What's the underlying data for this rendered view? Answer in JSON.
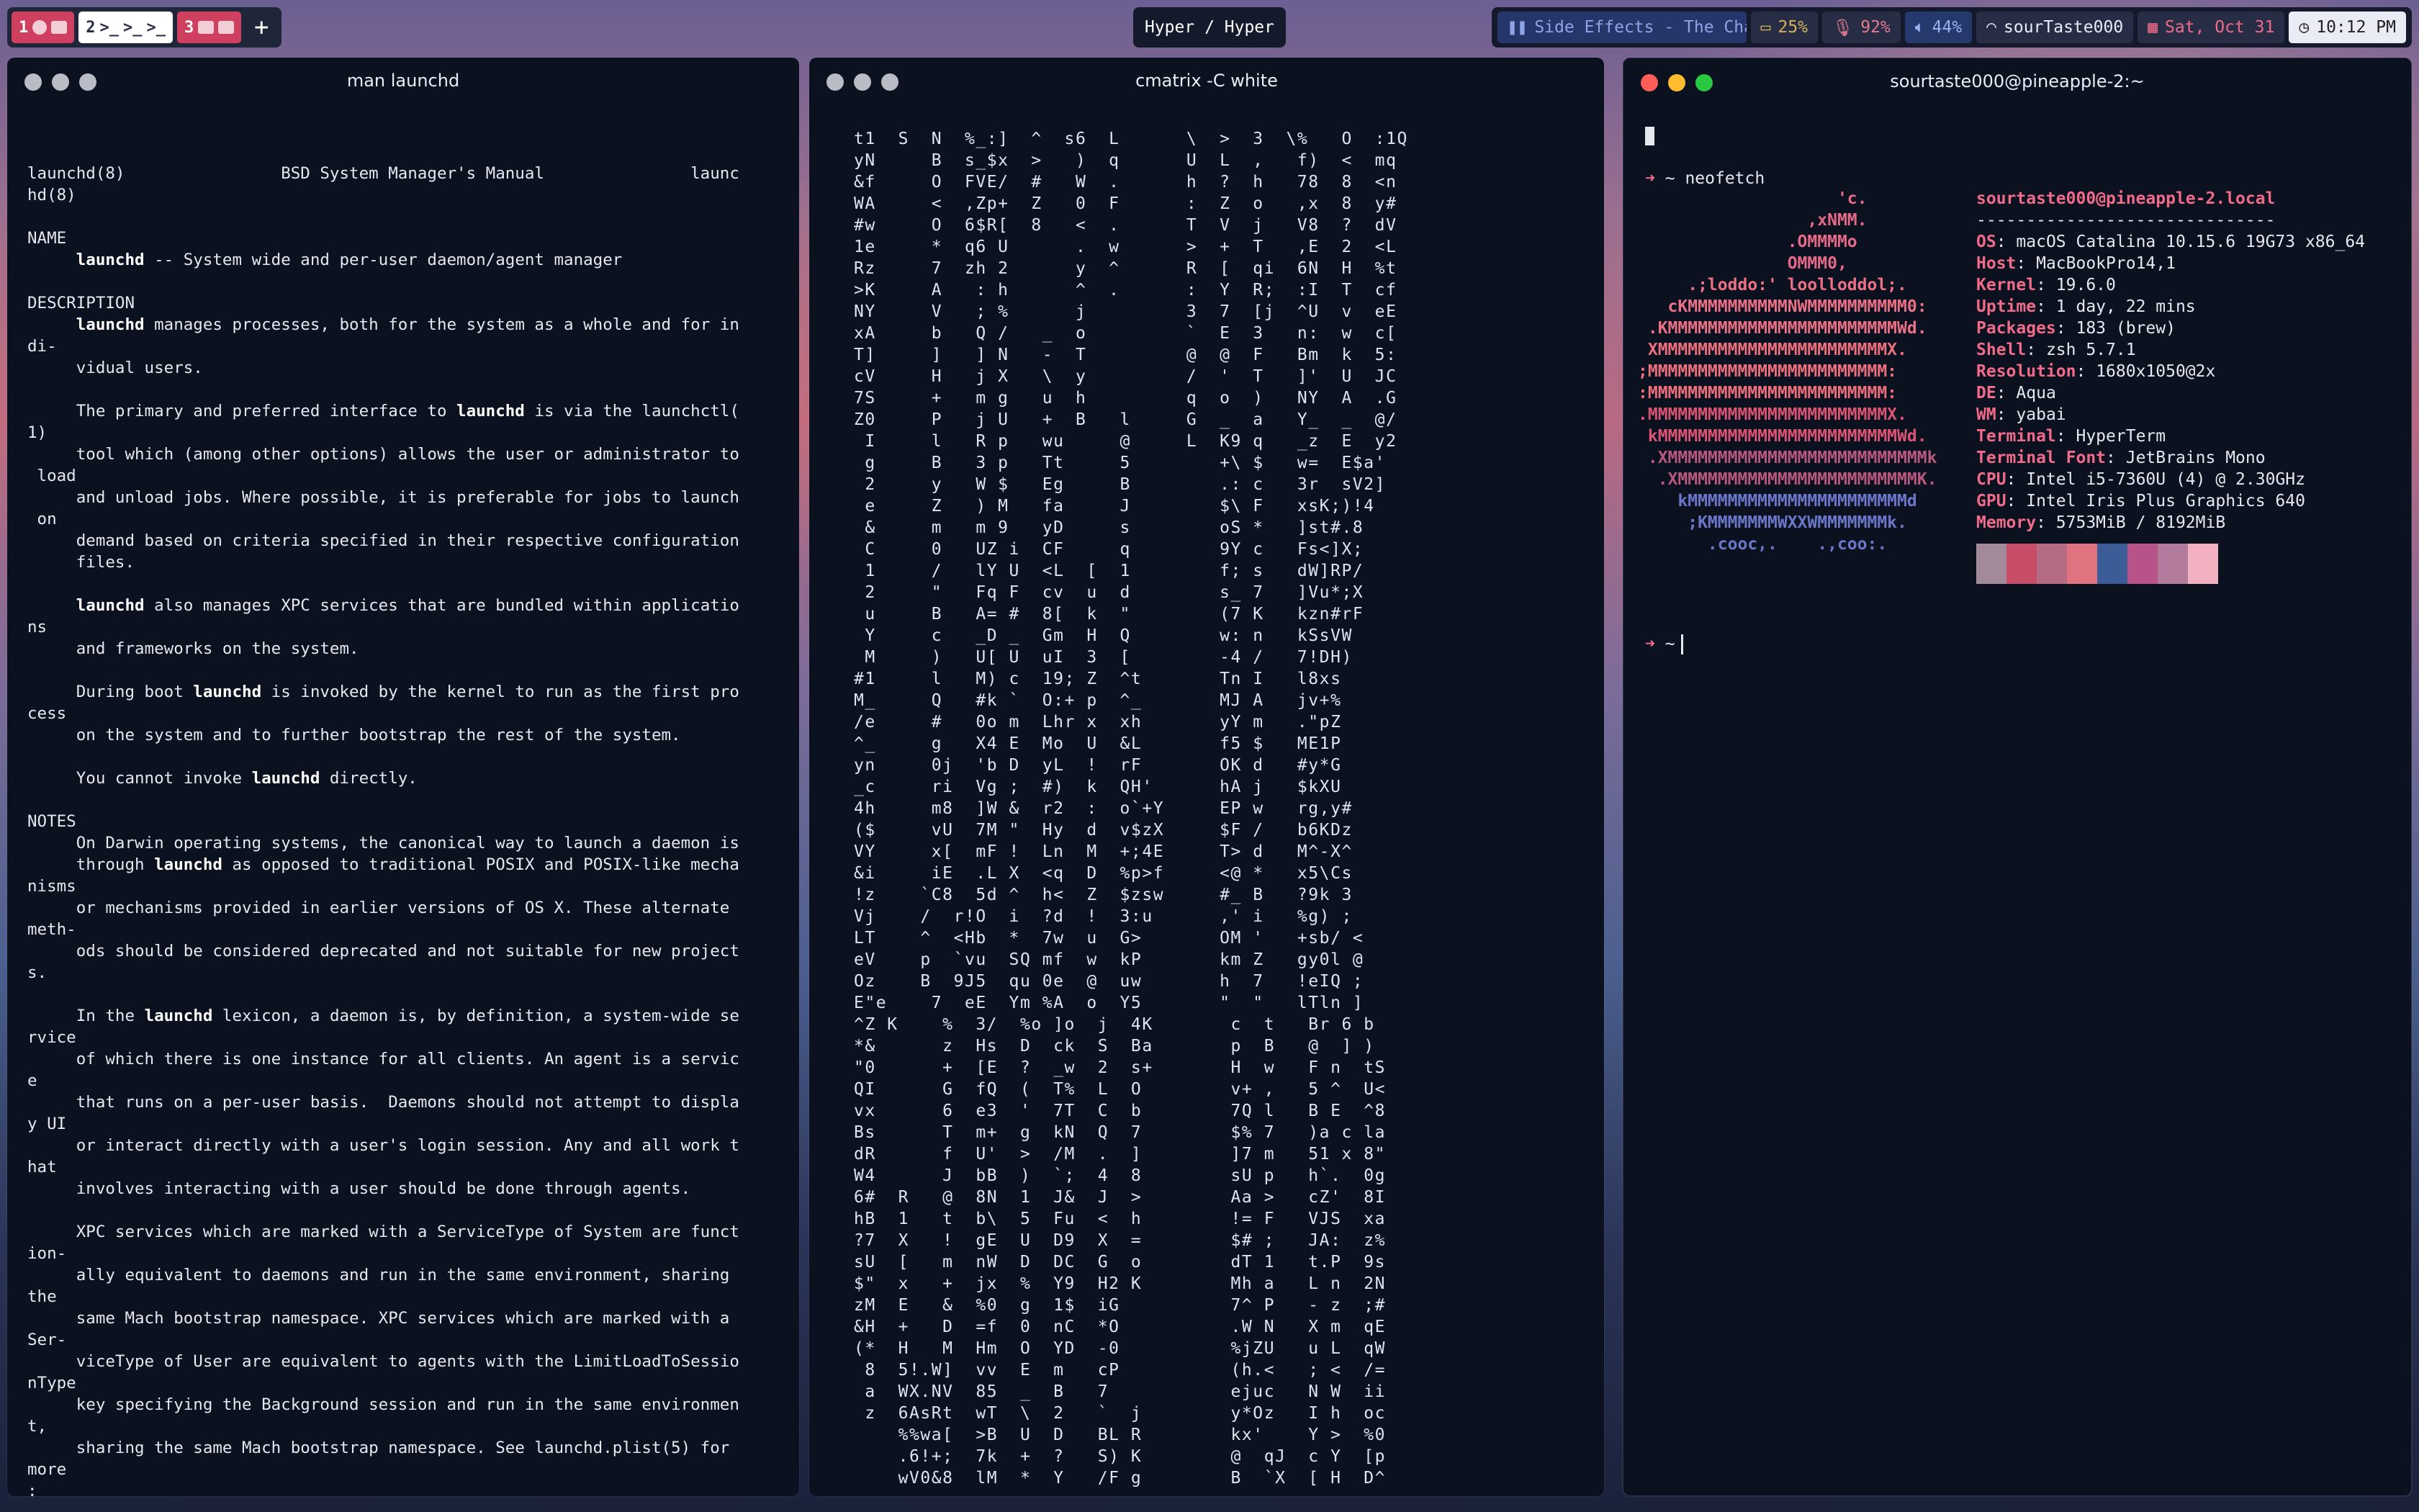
{
  "topbar": {
    "spaces": [
      {
        "num": "1"
      },
      {
        "num": "2"
      },
      {
        "num": "3"
      }
    ],
    "add_label": "+",
    "center_title": "Hyper / Hyper",
    "media": "Side Effects - The Chainsmokers",
    "battery": "25%",
    "mic": "92%",
    "volume": "44%",
    "wifi": "sourTaste000",
    "date": "Sat, Oct 31",
    "time": "10:12 PM"
  },
  "windows": {
    "man": {
      "title": "man launchd",
      "lines": [
        "launchd(8)                BSD System Manager's Manual               launc",
        "hd(8)",
        "",
        "NAME",
        "     **launchd** -- System wide and per-user daemon/agent manager",
        "",
        "DESCRIPTION",
        "     **launchd** manages processes, both for the system as a whole and for in",
        "di-",
        "     vidual users.",
        "",
        "     The primary and preferred interface to **launchd** is via the launchctl(",
        "1)",
        "     tool which (among other options) allows the user or administrator to",
        " load",
        "     and unload jobs. Where possible, it is preferable for jobs to launch",
        " on",
        "     demand based on criteria specified in their respective configuration",
        "     files.",
        "",
        "     **launchd** also manages XPC services that are bundled within applicatio",
        "ns",
        "     and frameworks on the system.",
        "",
        "     During boot **launchd** is invoked by the kernel to run as the first pro",
        "cess",
        "     on the system and to further bootstrap the rest of the system.",
        "",
        "     You cannot invoke **launchd** directly.",
        "",
        "NOTES",
        "     On Darwin operating systems, the canonical way to launch a daemon is",
        "     through **launchd** as opposed to traditional POSIX and POSIX-like mecha",
        "nisms",
        "     or mechanisms provided in earlier versions of OS X. These alternate",
        "meth-",
        "     ods should be considered deprecated and not suitable for new project",
        "s.",
        "",
        "     In the **launchd** lexicon, a daemon is, by definition, a system-wide se",
        "rvice",
        "     of which there is one instance for all clients. An agent is a servic",
        "e",
        "     that runs on a per-user basis.  Daemons should not attempt to displa",
        "y UI",
        "     or interact directly with a user's login session. Any and all work t",
        "hat",
        "     involves interacting with a user should be done through agents.",
        "",
        "     XPC services which are marked with a ServiceType of System are funct",
        "ion-",
        "     ally equivalent to daemons and run in the same environment, sharing",
        "the",
        "     same Mach bootstrap namespace. XPC services which are marked with a",
        "Ser-",
        "     viceType of User are equivalent to agents with the LimitLoadToSessio",
        "nType",
        "     key specifying the Background session and run in the same environmen",
        "t,",
        "     sharing the same Mach bootstrap namespace. See launchd.plist(5) for",
        "more",
        ":"
      ]
    },
    "cmatrix": {
      "title": "cmatrix -C white",
      "lines": [
        "t1  S  N  %_:]  ^  s6  L      \\  >  3  \\%   O  :1Q",
        "yN     B  s_$x  >   )  q      U  L  ,   f)  <  mq",
        "&f     O  FVE/  #   W  .      h  ?  h   78  8  <n",
        "WA     <  ,Zp+  Z   0  F      :  Z  o   ,x  8  y#",
        "#w     O  6$R[  8   <  .      T  V  j   V8  ?  dV",
        "1e     *  q6 U      .  w      >  +  T   ,E  2  <L",
        "Rz     7  zh 2      y  ^      R  [  qi  6N  H  %t",
        ">K     A   : h      ^  .      :  Y  R;  :I  T  cf",
        "NY     V   ; %      j         3  7  [j  ^U  v  eE",
        "xA     b   Q /   _  o         `  E  3   n:  w  c[",
        "T]     ]   ] N   -  T         @  @  F   Bm  k  5:",
        "cV     H   j X   \\  y         /  '  T   ]'  U  JC",
        "7S     +   m g   u  h         q  o  )   NY  A  .G",
        "Z0     P   j U   +  B   l     G  _  a   Y_  _  @/",
        " I     l   R p   wu     @     L  K9 q   _z  E  y2",
        " g     B   3 p   Tt     5        +\\ $   w=  E$a'",
        " 2     y   W $   Eg     B        .: c   3r  sV2]",
        " e     Z   ) M   fa     J        $\\ F   xsK;)!4",
        " &     m   m 9   yD     s        oS *   ]st#.8",
        " C     0   UZ i  CF     q        9Y c   Fs<]X;",
        " 1     /   lY U  <L  [  1        f; s   dW]RP/",
        " 2     \"   Fq F  cv  u  d        s_ 7   ]Vu*;X",
        " u     B   A= #  8[  k  \"        (7 K   kzn#rF",
        " Y     c   _D _  Gm  H  Q        w: n   kSsVW",
        " M     )   U[ U  uI  3  [        -4 /   7!DH)",
        "#1     l   M) c  19; Z  ^t       Tn I   l8xs",
        "M_     Q   #k `  O:+ p  ^_       MJ A   jv+%",
        "/e     #   0o m  Lhr x  xh       yY m   .\"pZ",
        "^_     g   X4 E  Mo  U  &L       f5 $   ME1P",
        "yn     0j  'b D  yL  !  rF       OK d   #y*G",
        "_c     ri  Vg ;  #)  k  QH'      hA j   $kXU",
        "4h     m8  ]W &  r2  :  o`+Y     EP w   rg,y#",
        "($     vU  7M \"  Hy  d  v$zX     $F /   b6KDz",
        "VY     x[  mF !  Ln  M  +;4E     T> d   M^-X^",
        "&i     iE  .L X  <q  D  %p>f     <@ *   x5\\Cs",
        "!z    `C8  5d ^  h<  Z  $zsw     #_ B   ?9k 3",
        "Vj    /  r!O  i  ?d  !  3:u      ,' i   %g) ;",
        "LT    ^  <Hb  *  7w  u  G>       OM '   +sb/ <",
        "eV    p  `vu  SQ mf  w  kP       km Z   gy0l @",
        "Oz    B  9J5  qu 0e  @  uw       h  7   !eIQ ;",
        "E\"e    7  eE  Ym %A  o  Y5       \"  \"   lTln ]",
        "^Z K    %  3/  %o ]o  j  4K       c  t   Br 6 b",
        "*&      z  Hs  D  ck  S  Ba       p  B   @  ] )",
        "\"0      +  [E  ?  _w  2  s+       H  w   F n  tS",
        "QI      G  fQ  (  T%  L  O        v+ ,   5 ^  U<",
        "vx      6  e3  '  7T  C  b        7Q l   B E  ^8",
        "Bs      T  m+  g  kN  Q  7        $% 7   )a c la",
        "dR      f  U'  >  /M  .  ]        ]7 m   51 x 8\"",
        "W4      J  bB  )  `;  4  8        sU p   h`.  0g",
        "6#  R   @  8N  1  J&  J  >        Aa >   cZ'  8I",
        "hB  1   t  b\\  5  Fu  <  h        != F   VJS  xa",
        "?7  X   !  gE  U  D9  X  =        $# ;   JA:  z%",
        "sU  [   m  nW  D  DC  G  o        dT 1   t.P  9s",
        "$\"  x   +  jx  %  Y9  H2 K        Mh a   L n  2N",
        "zM  E   &  %0  g  1$  iG          7^ P   - z  ;#",
        "&H  +   D  =f  0  nC  *O          .W N   X m  qE",
        "(*  H   M  Hm  O  YD  -0          %jZU   u L  qW",
        " 8  5!.W]  vv  E  m   cP          (h.<   ; <  /=",
        " a  WX.NV  85  _  B   7           ejuc   N W  ii",
        " z  6AsRt  wT  \\  2   `  j        y*Oz   I h  oc",
        "    %%wa[  >B  U  D   BL R        kx'    Y >  %0",
        "    .6!+;  7k  +  ?   S) K        @  qJ  c Y  [p",
        "    wV0&8  lM  *  Y   /F g        B  `X  [ H  D^"
      ]
    },
    "neofetch": {
      "title": "sourtaste000@pineapple-2:~",
      "cmd": "neofetch",
      "prompt_symbol": "~",
      "logo": [
        "                    'c.",
        "                 ,xNMM.",
        "               .OMMMMo",
        "               OMMM0,",
        "     .;loddo:' loolloddol;.",
        "   cKMMMMMMMMMMNWMMMMMMMMMM0:",
        " .KMMMMMMMMMMMMMMMMMMMMMMMWd.",
        " XMMMMMMMMMMMMMMMMMMMMMMMX.",
        ";MMMMMMMMMMMMMMMMMMMMMMMM:",
        ":MMMMMMMMMMMMMMMMMMMMMMMM:",
        ".MMMMMMMMMMMMMMMMMMMMMMMMX.",
        " kMMMMMMMMMMMMMMMMMMMMMMMMWd.",
        " .XMMMMMMMMMMMMMMMMMMMMMMMMMMk",
        "  .XMMMMMMMMMMMMMMMMMMMMMMMMK.",
        "    kMMMMMMMMMMMMMMMMMMMMMMd",
        "     ;KMMMMMMMWXXWMMMMMMMk.",
        "       .cooc,.    .,coo:."
      ],
      "user_host": "sourtaste000@pineapple-2.local",
      "separator": "------------------------------",
      "info": [
        {
          "k": "OS",
          "v": "macOS Catalina 10.15.6 19G73 x86_64"
        },
        {
          "k": "Host",
          "v": "MacBookPro14,1"
        },
        {
          "k": "Kernel",
          "v": "19.6.0"
        },
        {
          "k": "Uptime",
          "v": "1 day, 22 mins"
        },
        {
          "k": "Packages",
          "v": "183 (brew)"
        },
        {
          "k": "Shell",
          "v": "zsh 5.7.1"
        },
        {
          "k": "Resolution",
          "v": "1680x1050@2x"
        },
        {
          "k": "DE",
          "v": "Aqua"
        },
        {
          "k": "WM",
          "v": "yabai"
        },
        {
          "k": "Terminal",
          "v": "HyperTerm"
        },
        {
          "k": "Terminal Font",
          "v": "JetBrains Mono"
        },
        {
          "k": "CPU",
          "v": "Intel i5-7360U (4) @ 2.30GHz"
        },
        {
          "k": "GPU",
          "v": "Intel Iris Plus Graphics 640"
        },
        {
          "k": "Memory",
          "v": "5753MiB / 8192MiB"
        }
      ],
      "palette": [
        "#a38a9a",
        "#c84d66",
        "#b66b84",
        "#e17380",
        "#3c5c98",
        "#b8538a",
        "#b27a9b",
        "#f2b1c0"
      ]
    }
  }
}
